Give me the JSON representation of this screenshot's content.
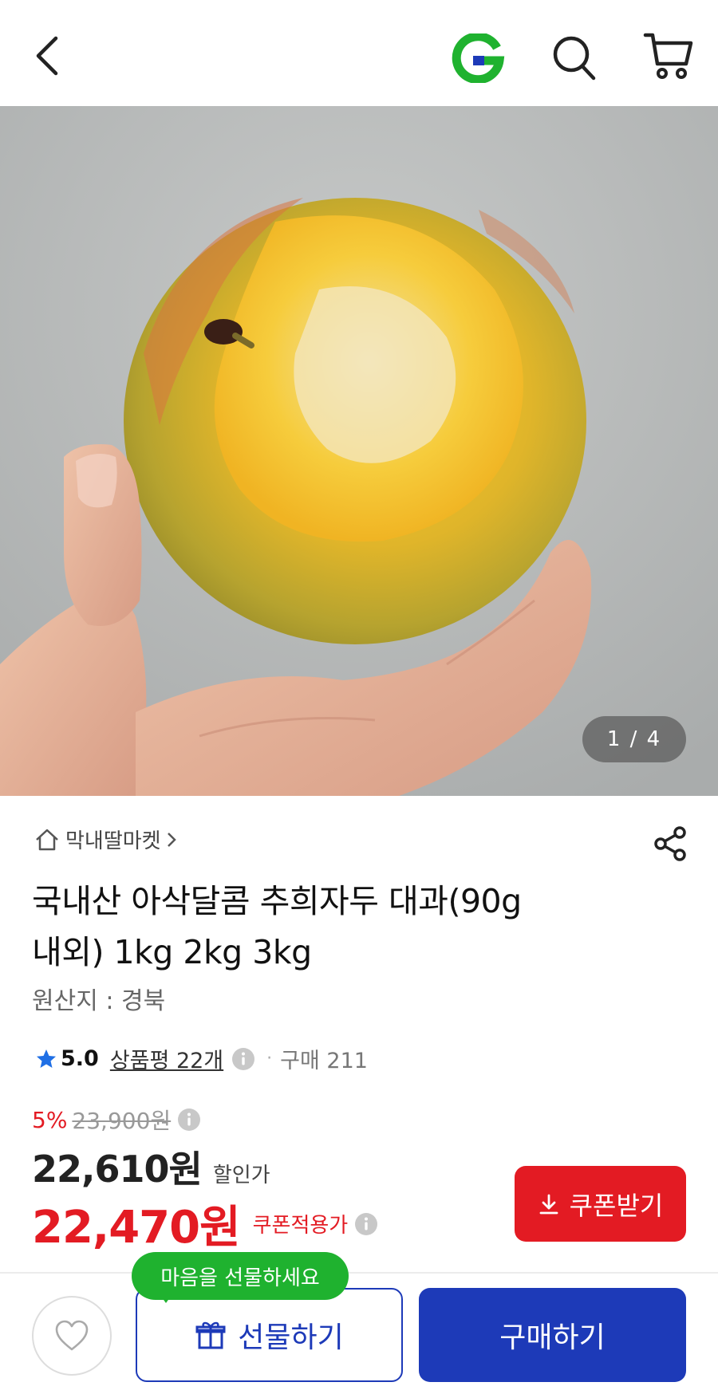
{
  "header": {
    "back_icon": "chevron-left-icon",
    "logo_icon": "gmarket-g-logo",
    "search_icon": "search-icon",
    "cart_icon": "cart-icon"
  },
  "gallery": {
    "pager": "1 / 4",
    "image": "plum-in-hand-photo"
  },
  "product": {
    "seller": "막내딸마켓",
    "title_line1": "국내산 아삭달콤 추희자두 대과(90g",
    "title_line2": "내외) 1kg 2kg 3kg",
    "origin": "원산지 : 경북",
    "rating": "5.0",
    "reviews": "상품평 22개",
    "purchase_count": "구매 211"
  },
  "price": {
    "discount_rate": "5%",
    "original_price": "23,900원",
    "sale_price": "22,610원",
    "sale_label": "할인가",
    "coupon_price": "22,470원",
    "coupon_label": "쿠폰적용가",
    "coupon_button": "쿠폰받기"
  },
  "bottom_bar": {
    "gift_tooltip": "마음을 선물하세요",
    "gift_button": "선물하기",
    "buy_button": "구매하기"
  },
  "colors": {
    "brand_blue": "#1d3ab8",
    "accent_red": "#e31b23",
    "tooltip_green": "#1fb22f",
    "logo_green": "#1fb22f"
  }
}
